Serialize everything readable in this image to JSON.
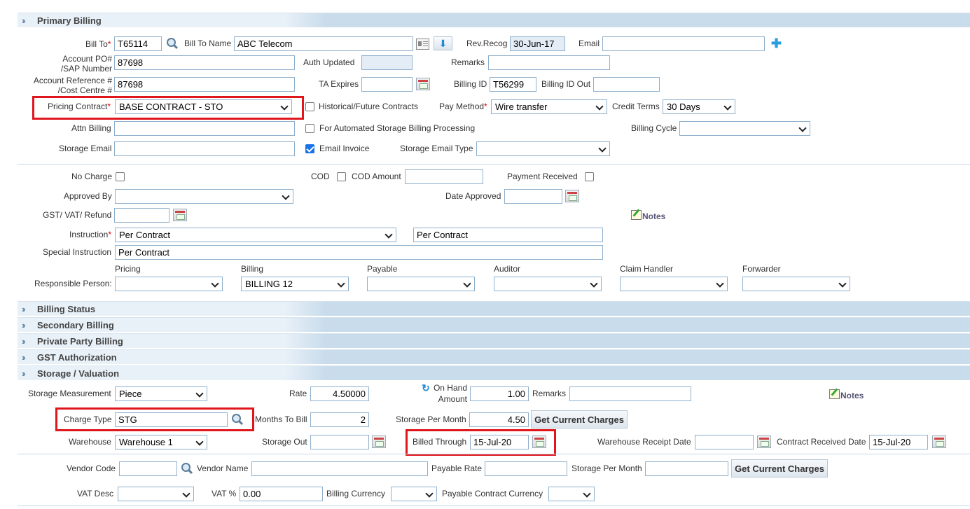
{
  "sections": {
    "primary_billing": "Primary Billing",
    "billing_status": "Billing Status",
    "secondary_billing": "Secondary Billing",
    "private_party_billing": "Private Party Billing",
    "gst_authorization": "GST Authorization",
    "storage_valuation": "Storage / Valuation"
  },
  "primary": {
    "bill_to_label": "Bill To",
    "bill_to_value": "T65114",
    "bill_to_name_label": "Bill To Name",
    "bill_to_name_value": "ABC Telecom",
    "rev_recog_label": "Rev.Recog",
    "rev_recog_value": "30-Jun-17",
    "email_label": "Email",
    "email_value": "",
    "account_po_label_1": "Account PO#",
    "account_po_label_2": "/SAP Number",
    "account_po_value": "87698",
    "auth_updated_label": "Auth Updated",
    "auth_updated_value": "",
    "remarks_label": "Remarks",
    "remarks_value": "",
    "account_ref_label_1": "Account Reference #",
    "account_ref_label_2": "/Cost Centre #",
    "account_ref_value": "87698",
    "ta_expires_label": "TA Expires",
    "ta_expires_value": "",
    "billing_id_label": "Billing ID",
    "billing_id_value": "T56299",
    "billing_id_out_label": "Billing ID Out",
    "billing_id_out_value": "",
    "pricing_contract_label": "Pricing Contract",
    "pricing_contract_value": "BASE CONTRACT - STO",
    "historical_label": "Historical/Future Contracts",
    "pay_method_label": "Pay Method",
    "pay_method_value": "Wire transfer",
    "credit_terms_label": "Credit Terms",
    "credit_terms_value": "30 Days",
    "attn_billing_label": "Attn Billing",
    "attn_billing_value": "",
    "automated_storage_label": "For Automated Storage Billing Processing",
    "billing_cycle_label": "Billing Cycle",
    "billing_cycle_value": "",
    "storage_email_label": "Storage Email",
    "storage_email_value": "",
    "email_invoice_label": "Email Invoice",
    "storage_email_type_label": "Storage Email Type",
    "storage_email_type_value": ""
  },
  "charges": {
    "no_charge_label": "No Charge",
    "cod_label": "COD",
    "cod_amount_label": "COD Amount",
    "cod_amount_value": "",
    "payment_received_label": "Payment Received",
    "approved_by_label": "Approved By",
    "approved_by_value": "",
    "date_approved_label": "Date Approved",
    "date_approved_value": "",
    "gst_label": "GST/ VAT/ Refund",
    "gst_value": "",
    "notes_label": "Notes",
    "instruction_label": "Instruction",
    "instruction_select": "Per Contract",
    "instruction_text": "Per Contract",
    "special_instruction_label": "Special Instruction",
    "special_instruction_value": "Per Contract",
    "responsible_person_label": "Responsible Person:",
    "resp_headers": [
      "Pricing",
      "Billing",
      "Payable",
      "Auditor",
      "Claim Handler",
      "Forwarder"
    ],
    "resp_values": [
      "",
      "BILLING 12",
      "",
      "",
      "",
      ""
    ]
  },
  "storage": {
    "measurement_label": "Storage Measurement",
    "measurement_value": "Piece",
    "rate_label": "Rate",
    "rate_value": "4.50000",
    "on_hand_label_1": "On Hand",
    "on_hand_label_2": "Amount",
    "on_hand_value": "1.00",
    "remarks_label": "Remarks",
    "remarks_value": "",
    "notes_label": "Notes",
    "charge_type_label": "Charge Type",
    "charge_type_value": "STG",
    "months_to_bill_label": "Months To Bill",
    "months_to_bill_value": "2",
    "storage_per_month_label": "Storage Per Month",
    "storage_per_month_value": "4.50",
    "get_current_charges": "Get Current Charges",
    "warehouse_label": "Warehouse",
    "warehouse_value": "Warehouse 1",
    "storage_out_label": "Storage Out",
    "storage_out_value": "",
    "billed_through_label": "Billed Through",
    "billed_through_value": "15-Jul-20",
    "warehouse_receipt_label": "Warehouse Receipt Date",
    "warehouse_receipt_value": "",
    "contract_received_label": "Contract Received Date",
    "contract_received_value": "15-Jul-20"
  },
  "vendor": {
    "vendor_code_label": "Vendor Code",
    "vendor_code_value": "",
    "vendor_name_label": "Vendor Name",
    "vendor_name_value": "",
    "payable_rate_label": "Payable Rate",
    "payable_rate_value": "",
    "storage_per_month_label": "Storage Per Month",
    "storage_per_month_value": "",
    "get_current_charges": "Get Current Charges",
    "vat_desc_label": "VAT Desc",
    "vat_desc_value": "",
    "vat_pct_label": "VAT %",
    "vat_pct_value": "0.00",
    "billing_currency_label": "Billing Currency",
    "billing_currency_value": "",
    "payable_currency_label": "Payable Contract Currency",
    "payable_currency_value": ""
  },
  "colors": {
    "highlight": "#e0161d",
    "section_bg": "#c9dcec",
    "accent": "#1a73e8"
  }
}
